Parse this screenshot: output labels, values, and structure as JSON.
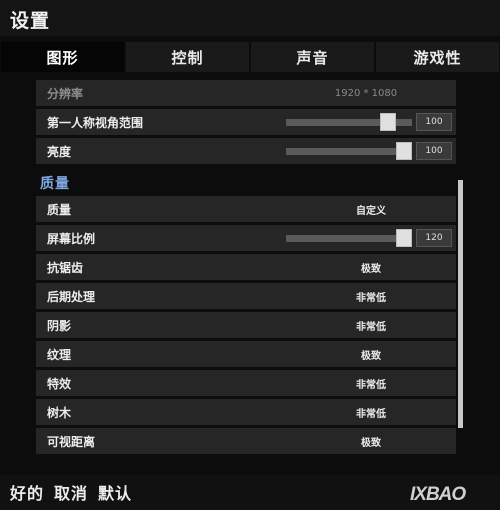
{
  "window": {
    "title": "设置"
  },
  "tabs": [
    {
      "label": "图形",
      "active": true
    },
    {
      "label": "控制",
      "active": false
    },
    {
      "label": "声音",
      "active": false
    },
    {
      "label": "游戏性",
      "active": false
    }
  ],
  "rows": [
    {
      "label": "分辨率",
      "value": "1920 * 1080",
      "type": "text",
      "dim": true
    },
    {
      "label": "第一人称视角范围",
      "value": "100",
      "type": "slider",
      "level": 0.85
    },
    {
      "label": "亮度",
      "value": "100",
      "type": "slider",
      "level": 1.0
    }
  ],
  "quality": {
    "heading": "质量",
    "rows": [
      {
        "label": "质量",
        "value": "自定义",
        "type": "text"
      },
      {
        "label": "屏幕比例",
        "value": "120",
        "type": "slider",
        "level": 1.0
      },
      {
        "label": "抗锯齿",
        "value": "极致",
        "type": "text"
      },
      {
        "label": "后期处理",
        "value": "非常低",
        "type": "text"
      },
      {
        "label": "阴影",
        "value": "非常低",
        "type": "text"
      },
      {
        "label": "纹理",
        "value": "极致",
        "type": "text"
      },
      {
        "label": "特效",
        "value": "非常低",
        "type": "text"
      },
      {
        "label": "树木",
        "value": "非常低",
        "type": "text"
      },
      {
        "label": "可视距离",
        "value": "极致",
        "type": "text"
      }
    ]
  },
  "footer": {
    "ok_label": "好的",
    "cancel_label": "取消",
    "default_label": "默认"
  },
  "watermark": {
    "text": "IXBAO"
  }
}
